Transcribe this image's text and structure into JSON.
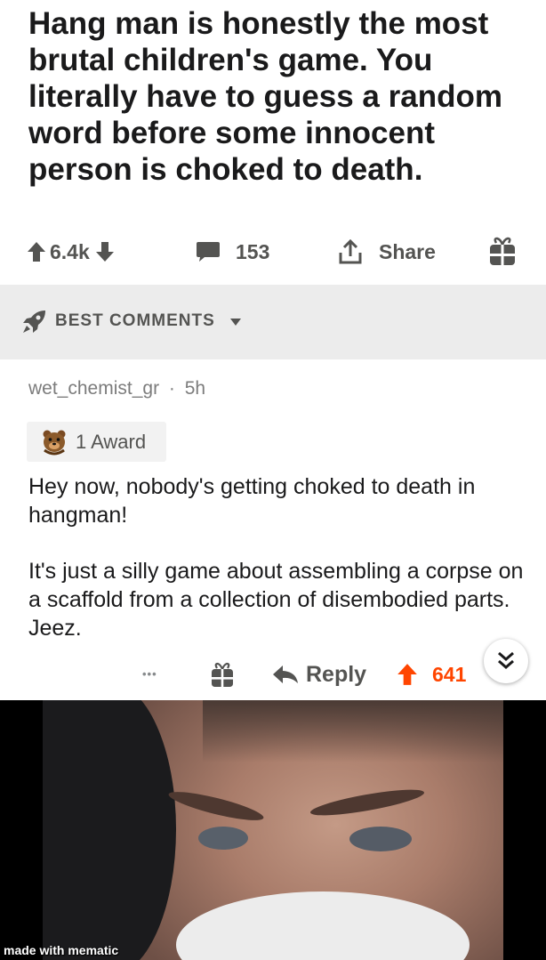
{
  "post": {
    "title": "Hang man is honestly the most brutal children's game. You literally have to guess a random word before some innocent person is choked to death.",
    "score": "6.4k",
    "comments": "153",
    "share_label": "Share"
  },
  "sort": {
    "label": "BEST COMMENTS"
  },
  "comment": {
    "author": "wet_chemist_gr",
    "separator": "·",
    "age": "5h",
    "award_label": "1 Award",
    "paragraphs": [
      "Hey now,  nobody's getting choked to death in hangman!",
      "It's just a silly game about assembling a corpse on a  scaffold from a collection of disembodied parts. Jeez."
    ],
    "more_label": "•••",
    "reply_label": "Reply",
    "score": "641"
  },
  "image": {
    "watermark": "made with mematic"
  },
  "colors": {
    "upvote_active": "#ff4500",
    "gray": "#545452",
    "sort_bg": "#ececec"
  },
  "icons": [
    "upvote-arrow-icon",
    "downvote-arrow-icon",
    "comment-bubble-icon",
    "share-icon",
    "gift-icon",
    "rocket-icon",
    "caret-down-icon",
    "bear-award-icon",
    "reply-arrow-icon",
    "double-chevron-down-icon"
  ]
}
